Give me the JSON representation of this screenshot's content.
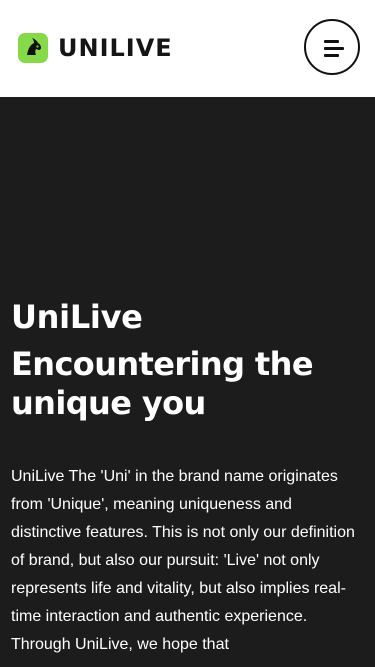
{
  "header": {
    "logo_text": "UNILIVE",
    "logo_icon": "unicorn-icon",
    "logo_color": "#86d948",
    "menu_icon": "hamburger-menu-icon"
  },
  "hero": {
    "brand": "UniLive",
    "tagline": "Encountering the unique you",
    "description": "UniLive⁣ The 'Uni' in the brand name originates from 'Unique', meaning uniqueness and distinctive features. This is not only our definition of brand, but also our pursuit: 'Live' not only represents life and vitality, but also implies real-time interaction and authentic experience. Through UniLive, we hope that"
  },
  "colors": {
    "header_background": "#ffffff",
    "hero_background": "#1c1c1c",
    "accent": "#86d948",
    "text_light": "#ffffff",
    "text_dark": "#151515"
  }
}
